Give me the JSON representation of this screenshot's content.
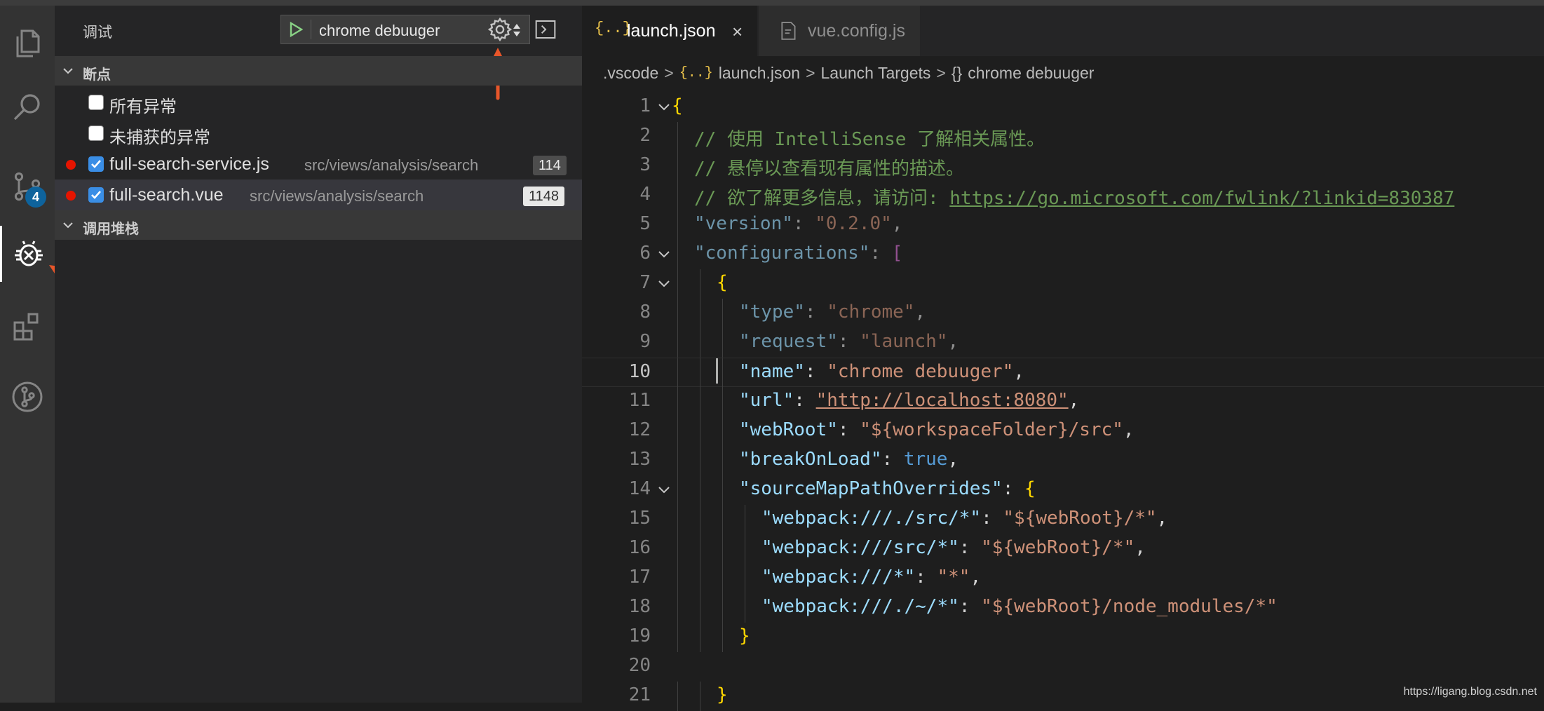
{
  "activity_bar": {
    "items": [
      {
        "icon": "files-icon"
      },
      {
        "icon": "search-icon"
      },
      {
        "icon": "source-control-icon",
        "badge": "4"
      },
      {
        "icon": "debug-icon",
        "active": true
      },
      {
        "icon": "extensions-icon"
      },
      {
        "icon": "git-graph-icon"
      }
    ]
  },
  "sidebar": {
    "title": "调试",
    "config_select": "chrome debuuger",
    "breakpoints_section": "断点",
    "callstack_section": "调用堆栈",
    "exception_options": [
      {
        "label": "所有异常",
        "checked": false
      },
      {
        "label": "未捕获的异常",
        "checked": false
      }
    ],
    "breakpoints": [
      {
        "file": "full-search-service.js",
        "path": "src/views/analysis/search",
        "line": "114",
        "checked": true
      },
      {
        "file": "full-search.vue",
        "path": "src/views/analysis/search",
        "line": "1148",
        "checked": true
      }
    ]
  },
  "editor": {
    "tabs": [
      {
        "icon": "{..}",
        "label": "launch.json",
        "active": true,
        "close": "×"
      },
      {
        "icon": "vue-file-icon",
        "label": "vue.config.js",
        "active": false
      }
    ],
    "breadcrumb": {
      "folder": ".vscode",
      "file_icon": "{..}",
      "file": "launch.json",
      "section": "Launch Targets",
      "obj_icon": "{}",
      "item": "chrome debuuger",
      "sep": ">"
    },
    "current_line": 10,
    "lines": [
      {
        "n": "1",
        "fold": true,
        "indent": 0,
        "tokens": [
          [
            "br",
            "{"
          ]
        ]
      },
      {
        "n": "2",
        "indent": 1,
        "tokens": [
          [
            "cm",
            "// 使用 IntelliSense 了解相关属性。"
          ]
        ]
      },
      {
        "n": "3",
        "indent": 1,
        "tokens": [
          [
            "cm",
            "// 悬停以查看现有属性的描述。"
          ]
        ]
      },
      {
        "n": "4",
        "indent": 1,
        "tokens": [
          [
            "cm",
            "// 欲了解更多信息，请访问: "
          ],
          [
            "url",
            "https://go.microsoft.com/fwlink/?linkid=830387"
          ]
        ]
      },
      {
        "n": "5",
        "indent": 1,
        "dim": true,
        "tokens": [
          [
            "key",
            "\"version\""
          ],
          [
            "pun",
            ": "
          ],
          [
            "str",
            "\"0.2.0\""
          ],
          [
            "pun",
            ","
          ]
        ]
      },
      {
        "n": "6",
        "fold": true,
        "indent": 1,
        "dim": true,
        "tokens": [
          [
            "key",
            "\"configurations\""
          ],
          [
            "pun",
            ": "
          ],
          [
            "pk",
            "["
          ]
        ]
      },
      {
        "n": "7",
        "fold": true,
        "indent": 2,
        "tokens": [
          [
            "br",
            "{"
          ]
        ]
      },
      {
        "n": "8",
        "indent": 3,
        "dim": true,
        "tokens": [
          [
            "key",
            "\"type\""
          ],
          [
            "pun",
            ": "
          ],
          [
            "str",
            "\"chrome\""
          ],
          [
            "pun",
            ","
          ]
        ]
      },
      {
        "n": "9",
        "indent": 3,
        "dim": true,
        "tokens": [
          [
            "key",
            "\"request\""
          ],
          [
            "pun",
            ": "
          ],
          [
            "str",
            "\"launch\""
          ],
          [
            "pun",
            ","
          ]
        ]
      },
      {
        "n": "10",
        "indent": 3,
        "tokens": [
          [
            "key",
            "\"name\""
          ],
          [
            "pun",
            ": "
          ],
          [
            "str",
            "\"chrome debuuger\""
          ],
          [
            "pun",
            ","
          ]
        ]
      },
      {
        "n": "11",
        "indent": 3,
        "tokens": [
          [
            "key",
            "\"url\""
          ],
          [
            "pun",
            ": "
          ],
          [
            "strurl",
            "\"http://localhost:8080\""
          ],
          [
            "pun",
            ","
          ]
        ]
      },
      {
        "n": "12",
        "indent": 3,
        "tokens": [
          [
            "key",
            "\"webRoot\""
          ],
          [
            "pun",
            ": "
          ],
          [
            "str",
            "\"${workspaceFolder}/src\""
          ],
          [
            "pun",
            ","
          ]
        ]
      },
      {
        "n": "13",
        "indent": 3,
        "tokens": [
          [
            "key",
            "\"breakOnLoad\""
          ],
          [
            "pun",
            ": "
          ],
          [
            "bool",
            "true"
          ],
          [
            "pun",
            ","
          ]
        ]
      },
      {
        "n": "14",
        "fold": true,
        "indent": 3,
        "tokens": [
          [
            "key",
            "\"sourceMapPathOverrides\""
          ],
          [
            "pun",
            ": "
          ],
          [
            "br",
            "{"
          ]
        ]
      },
      {
        "n": "15",
        "indent": 4,
        "tokens": [
          [
            "key",
            "\"webpack:///./src/*\""
          ],
          [
            "pun",
            ": "
          ],
          [
            "str",
            "\"${webRoot}/*\""
          ],
          [
            "pun",
            ","
          ]
        ]
      },
      {
        "n": "16",
        "indent": 4,
        "tokens": [
          [
            "key",
            "\"webpack:///src/*\""
          ],
          [
            "pun",
            ": "
          ],
          [
            "str",
            "\"${webRoot}/*\""
          ],
          [
            "pun",
            ","
          ]
        ]
      },
      {
        "n": "17",
        "indent": 4,
        "tokens": [
          [
            "key",
            "\"webpack:///*\""
          ],
          [
            "pun",
            ": "
          ],
          [
            "str",
            "\"*\""
          ],
          [
            "pun",
            ","
          ]
        ]
      },
      {
        "n": "18",
        "indent": 4,
        "tokens": [
          [
            "key",
            "\"webpack:///./~/*\""
          ],
          [
            "pun",
            ": "
          ],
          [
            "str",
            "\"${webRoot}/node_modules/*\""
          ]
        ]
      },
      {
        "n": "19",
        "indent": 3,
        "tokens": [
          [
            "br",
            "}"
          ]
        ]
      },
      {
        "n": "20",
        "indent": 0,
        "tokens": []
      },
      {
        "n": "21",
        "indent": 2,
        "tokens": [
          [
            "br",
            "}"
          ]
        ]
      }
    ]
  },
  "watermark": "https://ligang.blog.csdn.net",
  "colors": {
    "activity_bg": "#333333",
    "sidebar_bg": "#252526",
    "editor_bg": "#1e1e1e",
    "badge": "#0e639c",
    "breakpoint": "#e51400",
    "annotation_arrow": "#e8562a"
  }
}
